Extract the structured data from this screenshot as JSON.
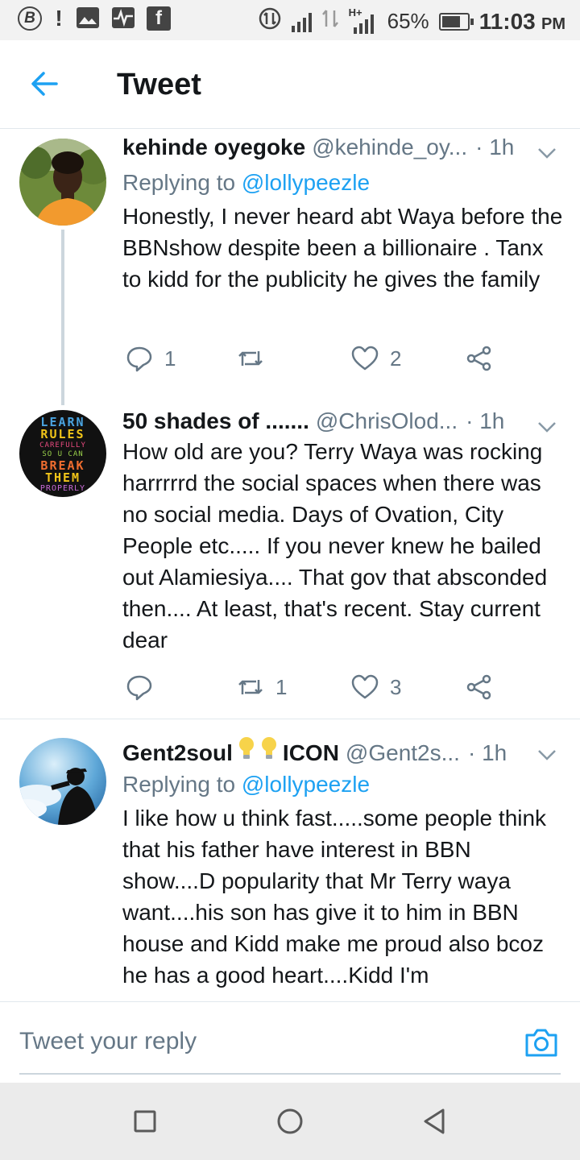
{
  "status_bar": {
    "network_label": "H+",
    "battery_percent": "65%",
    "time": "11:03",
    "ampm": "PM"
  },
  "header": {
    "title": "Tweet"
  },
  "tweets": [
    {
      "name": "kehinde oyegoke",
      "handle": "@kehinde_oy...",
      "time": "· 1h",
      "replying_prefix": "Replying to",
      "replying_to": "@lollypeezle",
      "text": "Honestly, I never heard abt Waya before the BBNshow despite been a billionaire . Tanx to kidd for the publicity he gives the family",
      "reply_count": "1",
      "retweet_count": "",
      "like_count": "2"
    },
    {
      "name": "50 shades of .......",
      "handle": "@ChrisOlod...",
      "time": "· 1h",
      "avatar_text": [
        "LEARN",
        "RULES",
        "CAREFULLY",
        "SO U CAN",
        "BREAK",
        "THEM",
        "PROPERLY"
      ],
      "text": "How old are you? Terry Waya was rocking harrrrrd the social spaces when there was no social media. Days of Ovation, City People etc..... If you never knew he bailed out Alamiesiya.... That gov that absconded then.... At least, that's recent. Stay current dear",
      "reply_count": "",
      "retweet_count": "1",
      "like_count": "3"
    },
    {
      "name": "Gent2soul",
      "name_suffix": "ICON",
      "handle": "@Gent2s...",
      "time": "· 1h",
      "replying_prefix": "Replying to",
      "replying_to": "@lollypeezle",
      "text": "I like how u think fast.....some people think that his father have interest in BBN show....D popularity that Mr Terry waya want....his son has give it to him in BBN house and Kidd make me proud also bcoz he has a good heart....Kidd I'm"
    }
  ],
  "reply_bar": {
    "placeholder": "Tweet your reply"
  },
  "colors": {
    "accent": "#1da1f2",
    "secondary_text": "#657786",
    "divider": "#e1e8ed"
  }
}
